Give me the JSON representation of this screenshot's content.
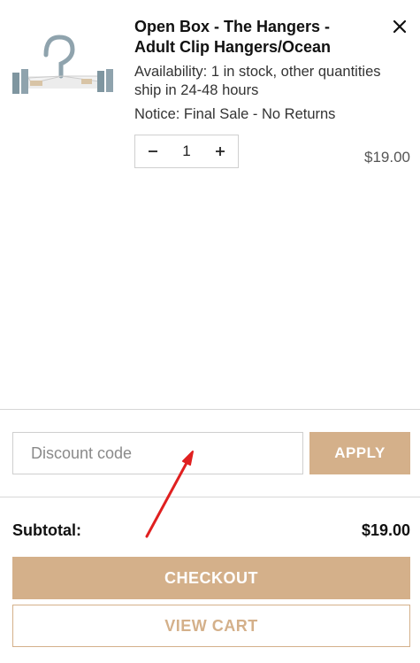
{
  "cart_item": {
    "title": "Open Box - The Hangers - Adult Clip Hangers/Ocean",
    "availability": "Availability: 1 in stock, other quantities ship in 24-48 hours",
    "notice": "Notice: Final Sale - No Returns",
    "quantity": "1",
    "price": "$19.00",
    "remove_icon": "close-icon",
    "decrease_icon": "minus-icon",
    "increase_icon": "plus-icon"
  },
  "discount": {
    "placeholder": "Discount code",
    "apply_label": "APPLY"
  },
  "summary": {
    "subtotal_label": "Subtotal:",
    "subtotal_value": "$19.00"
  },
  "actions": {
    "checkout_label": "CHECKOUT",
    "view_cart_label": "VIEW CART"
  },
  "colors": {
    "accent": "#d4b08a",
    "annotation_arrow": "#e02020"
  }
}
